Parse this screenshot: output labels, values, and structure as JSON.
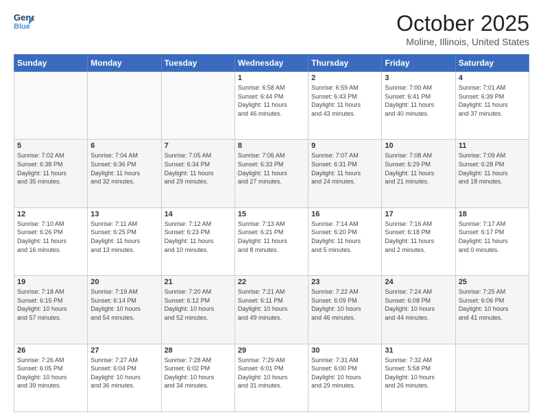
{
  "header": {
    "logo_line1": "General",
    "logo_line2": "Blue",
    "month": "October 2025",
    "location": "Moline, Illinois, United States"
  },
  "weekdays": [
    "Sunday",
    "Monday",
    "Tuesday",
    "Wednesday",
    "Thursday",
    "Friday",
    "Saturday"
  ],
  "weeks": [
    [
      {
        "day": "",
        "info": ""
      },
      {
        "day": "",
        "info": ""
      },
      {
        "day": "",
        "info": ""
      },
      {
        "day": "1",
        "info": "Sunrise: 6:58 AM\nSunset: 6:44 PM\nDaylight: 11 hours\nand 46 minutes."
      },
      {
        "day": "2",
        "info": "Sunrise: 6:59 AM\nSunset: 6:43 PM\nDaylight: 11 hours\nand 43 minutes."
      },
      {
        "day": "3",
        "info": "Sunrise: 7:00 AM\nSunset: 6:41 PM\nDaylight: 11 hours\nand 40 minutes."
      },
      {
        "day": "4",
        "info": "Sunrise: 7:01 AM\nSunset: 6:39 PM\nDaylight: 11 hours\nand 37 minutes."
      }
    ],
    [
      {
        "day": "5",
        "info": "Sunrise: 7:02 AM\nSunset: 6:38 PM\nDaylight: 11 hours\nand 35 minutes."
      },
      {
        "day": "6",
        "info": "Sunrise: 7:04 AM\nSunset: 6:36 PM\nDaylight: 11 hours\nand 32 minutes."
      },
      {
        "day": "7",
        "info": "Sunrise: 7:05 AM\nSunset: 6:34 PM\nDaylight: 11 hours\nand 29 minutes."
      },
      {
        "day": "8",
        "info": "Sunrise: 7:06 AM\nSunset: 6:33 PM\nDaylight: 11 hours\nand 27 minutes."
      },
      {
        "day": "9",
        "info": "Sunrise: 7:07 AM\nSunset: 6:31 PM\nDaylight: 11 hours\nand 24 minutes."
      },
      {
        "day": "10",
        "info": "Sunrise: 7:08 AM\nSunset: 6:29 PM\nDaylight: 11 hours\nand 21 minutes."
      },
      {
        "day": "11",
        "info": "Sunrise: 7:09 AM\nSunset: 6:28 PM\nDaylight: 11 hours\nand 18 minutes."
      }
    ],
    [
      {
        "day": "12",
        "info": "Sunrise: 7:10 AM\nSunset: 6:26 PM\nDaylight: 11 hours\nand 16 minutes."
      },
      {
        "day": "13",
        "info": "Sunrise: 7:11 AM\nSunset: 6:25 PM\nDaylight: 11 hours\nand 13 minutes."
      },
      {
        "day": "14",
        "info": "Sunrise: 7:12 AM\nSunset: 6:23 PM\nDaylight: 11 hours\nand 10 minutes."
      },
      {
        "day": "15",
        "info": "Sunrise: 7:13 AM\nSunset: 6:21 PM\nDaylight: 11 hours\nand 8 minutes."
      },
      {
        "day": "16",
        "info": "Sunrise: 7:14 AM\nSunset: 6:20 PM\nDaylight: 11 hours\nand 5 minutes."
      },
      {
        "day": "17",
        "info": "Sunrise: 7:16 AM\nSunset: 6:18 PM\nDaylight: 11 hours\nand 2 minutes."
      },
      {
        "day": "18",
        "info": "Sunrise: 7:17 AM\nSunset: 6:17 PM\nDaylight: 11 hours\nand 0 minutes."
      }
    ],
    [
      {
        "day": "19",
        "info": "Sunrise: 7:18 AM\nSunset: 6:15 PM\nDaylight: 10 hours\nand 57 minutes."
      },
      {
        "day": "20",
        "info": "Sunrise: 7:19 AM\nSunset: 6:14 PM\nDaylight: 10 hours\nand 54 minutes."
      },
      {
        "day": "21",
        "info": "Sunrise: 7:20 AM\nSunset: 6:12 PM\nDaylight: 10 hours\nand 52 minutes."
      },
      {
        "day": "22",
        "info": "Sunrise: 7:21 AM\nSunset: 6:11 PM\nDaylight: 10 hours\nand 49 minutes."
      },
      {
        "day": "23",
        "info": "Sunrise: 7:22 AM\nSunset: 6:09 PM\nDaylight: 10 hours\nand 46 minutes."
      },
      {
        "day": "24",
        "info": "Sunrise: 7:24 AM\nSunset: 6:08 PM\nDaylight: 10 hours\nand 44 minutes."
      },
      {
        "day": "25",
        "info": "Sunrise: 7:25 AM\nSunset: 6:06 PM\nDaylight: 10 hours\nand 41 minutes."
      }
    ],
    [
      {
        "day": "26",
        "info": "Sunrise: 7:26 AM\nSunset: 6:05 PM\nDaylight: 10 hours\nand 39 minutes."
      },
      {
        "day": "27",
        "info": "Sunrise: 7:27 AM\nSunset: 6:04 PM\nDaylight: 10 hours\nand 36 minutes."
      },
      {
        "day": "28",
        "info": "Sunrise: 7:28 AM\nSunset: 6:02 PM\nDaylight: 10 hours\nand 34 minutes."
      },
      {
        "day": "29",
        "info": "Sunrise: 7:29 AM\nSunset: 6:01 PM\nDaylight: 10 hours\nand 31 minutes."
      },
      {
        "day": "30",
        "info": "Sunrise: 7:31 AM\nSunset: 6:00 PM\nDaylight: 10 hours\nand 29 minutes."
      },
      {
        "day": "31",
        "info": "Sunrise: 7:32 AM\nSunset: 5:58 PM\nDaylight: 10 hours\nand 26 minutes."
      },
      {
        "day": "",
        "info": ""
      }
    ]
  ]
}
